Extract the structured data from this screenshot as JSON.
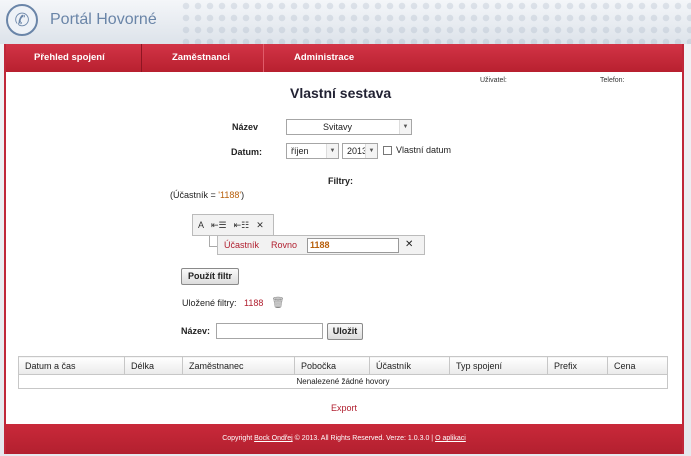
{
  "header": {
    "app_title": "Portál Hovorné",
    "logo_icon": "phone-icon"
  },
  "nav": {
    "items": [
      "Přehled spojení",
      "Zaměstnanci",
      "Administrace"
    ]
  },
  "user": {
    "user_label": "Uživatel:",
    "phone_label": "Telefon:"
  },
  "page": {
    "title": "Vlastní sestava"
  },
  "form": {
    "name_label": "Název",
    "name_value": "Svitavy",
    "date_label": "Datum:",
    "month_value": "říjen",
    "year_value": "2013",
    "custom_date_label": "Vlastní datum",
    "filters_label": "Filtry:",
    "filter_expr_open": "(Účastník = ",
    "filter_expr_value": "'1188'",
    "filter_expr_close": ")"
  },
  "filter_builder": {
    "group_buttons": [
      "A",
      "⇤☰",
      "⇤☷",
      "✕"
    ],
    "rule_field": "Účastník",
    "rule_operator": "Rovno",
    "rule_value": "1188",
    "rule_delete": "✕"
  },
  "actions": {
    "apply_filter": "Použít filtr",
    "saved_filters_label": "Uložené filtry:",
    "saved_filter_item": "1188",
    "save_name_label": "Název:",
    "save_button": "Uložit"
  },
  "table": {
    "columns": [
      "Datum a čas",
      "Délka",
      "Zaměstnanec",
      "Pobočka",
      "Účastník",
      "Typ spojení",
      "Prefix",
      "Cena"
    ],
    "empty_message": "Nenalezené žádné hovory"
  },
  "export_label": "Export",
  "footer": {
    "copyright_prefix": "Copyright",
    "author": "Bock Ondřej",
    "rest": "© 2013. All Rights Reserved. Verze: 1.0.3.0 |",
    "about": "O aplikaci"
  },
  "colors": {
    "brand_red": "#c0283a",
    "accent_blue": "#6a85a8",
    "value_orange": "#b8600c"
  }
}
